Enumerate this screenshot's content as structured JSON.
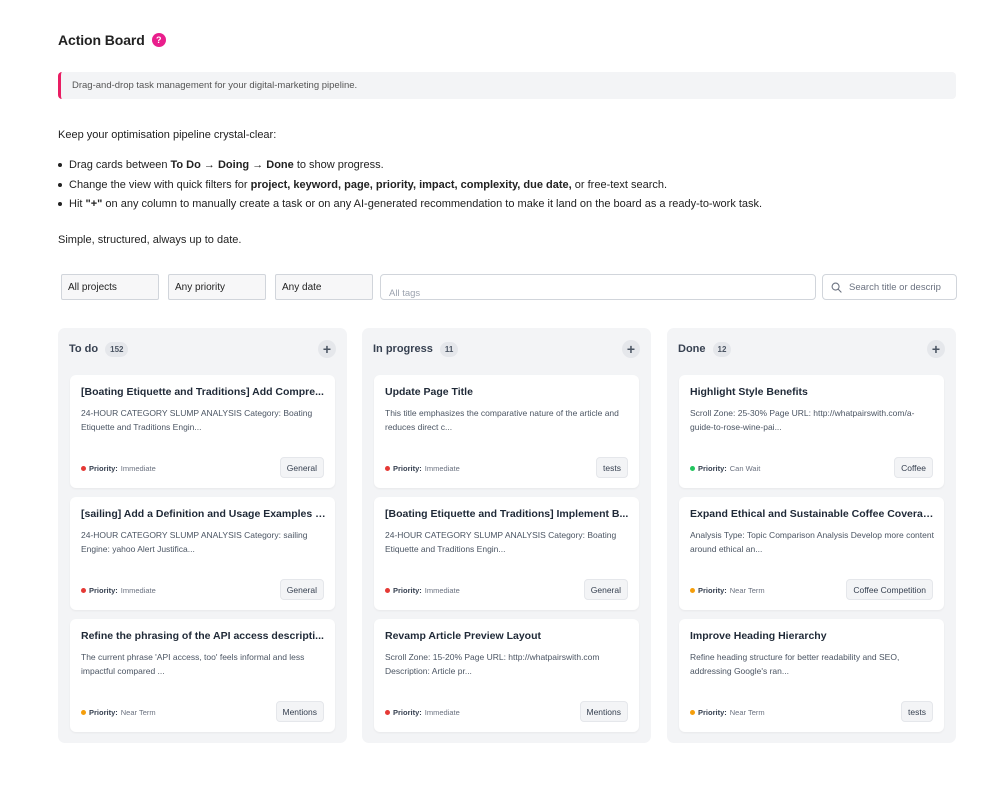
{
  "header": {
    "title": "Action Board",
    "help_icon_glyph": "?"
  },
  "notice": "Drag-and-drop task management for your digital-marketing pipeline.",
  "intro": "Keep your optimisation pipeline crystal-clear:",
  "bullets": {
    "b1_pre": "Drag cards between ",
    "b1_todo": "To Do",
    "b1_arrow1": " → ",
    "b1_doing": "Doing",
    "b1_arrow2": " → ",
    "b1_done": "Done",
    "b1_post": " to show progress.",
    "b2_pre": "Change the view with quick filters for ",
    "b2_bold": "project, keyword, page, priority, impact, complexity, due date,",
    "b2_post": " or free-text search.",
    "b3_pre": "Hit ",
    "b3_bold": "\"+\"",
    "b3_post": " on any column to manually create a task or on any AI-generated recommendation to make it land on the board as a ready-to-work task."
  },
  "outro": "Simple, structured, always up to date.",
  "filters": {
    "projects": "All projects",
    "priority": "Any priority",
    "date": "Any date",
    "tags_placeholder": "All tags",
    "search_placeholder": "Search title or descrip"
  },
  "colors": {
    "accent_pink": "#e91e8c",
    "priority_immediate": "#e53935",
    "priority_can_wait": "#22c55e",
    "priority_near_term": "#f59e0b"
  },
  "columns": [
    {
      "title": "To do",
      "count": "152",
      "add_glyph": "+",
      "cards": [
        {
          "title": "[Boating Etiquette and Traditions] Add Compre...",
          "desc": "24-HOUR CATEGORY SLUMP ANALYSIS Category: Boating Etiquette and Traditions Engin...",
          "priority_label": "Priority:",
          "priority": "Immediate",
          "tag": "General"
        },
        {
          "title": "[sailing] Add a Definition and Usage Examples f...",
          "desc": "24-HOUR CATEGORY SLUMP ANALYSIS Category: sailing Engine: yahoo Alert Justifica...",
          "priority_label": "Priority:",
          "priority": "Immediate",
          "tag": "General"
        },
        {
          "title": "Refine the phrasing of the API access descripti...",
          "desc": "The current phrase 'API access, too' feels informal and less impactful compared ...",
          "priority_label": "Priority:",
          "priority": "Near Term",
          "tag": "Mentions"
        }
      ]
    },
    {
      "title": "In progress",
      "count": "11",
      "add_glyph": "+",
      "cards": [
        {
          "title": "Update Page Title",
          "desc": "This title emphasizes the comparative nature of the article and reduces direct c...",
          "priority_label": "Priority:",
          "priority": "Immediate",
          "tag": "tests"
        },
        {
          "title": "[Boating Etiquette and Traditions] Implement B...",
          "desc": "24-HOUR CATEGORY SLUMP ANALYSIS Category: Boating Etiquette and Traditions Engin...",
          "priority_label": "Priority:",
          "priority": "Immediate",
          "tag": "General"
        },
        {
          "title": "Revamp Article Preview Layout",
          "desc": "Scroll Zone: 15-20% Page URL: http://whatpairswith.com Description: Article pr...",
          "priority_label": "Priority:",
          "priority": "Immediate",
          "tag": "Mentions"
        }
      ]
    },
    {
      "title": "Done",
      "count": "12",
      "add_glyph": "+",
      "cards": [
        {
          "title": "Highlight Style Benefits",
          "desc": "Scroll Zone: 25-30% Page URL: http://whatpairswith.com/a-guide-to-rose-wine-pai...",
          "priority_label": "Priority:",
          "priority": "Can Wait",
          "tag": "Coffee"
        },
        {
          "title": "Expand Ethical and Sustainable Coffee Coverage",
          "desc": "Analysis Type: Topic Comparison Analysis Develop more content around ethical an...",
          "priority_label": "Priority:",
          "priority": "Near Term",
          "tag": "Coffee Competition"
        },
        {
          "title": "Improve Heading Hierarchy",
          "desc": "Refine heading structure for better readability and SEO, addressing Google's ran...",
          "priority_label": "Priority:",
          "priority": "Near Term",
          "tag": "tests"
        }
      ]
    }
  ]
}
